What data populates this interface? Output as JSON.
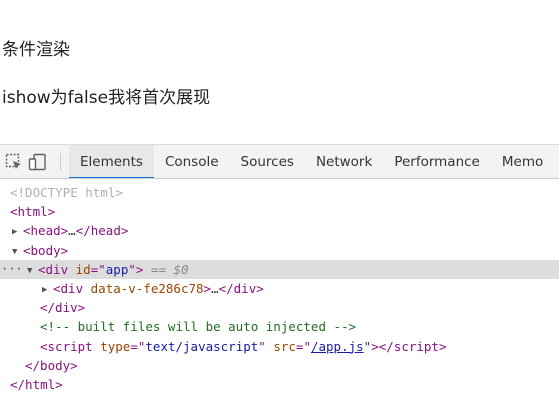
{
  "page": {
    "line1": "条件渲染",
    "line2": "ishow为false我将首次展现"
  },
  "devtools": {
    "tabs": [
      {
        "label": "Elements",
        "active": true
      },
      {
        "label": "Console",
        "active": false
      },
      {
        "label": "Sources",
        "active": false
      },
      {
        "label": "Network",
        "active": false
      },
      {
        "label": "Performance",
        "active": false
      },
      {
        "label": "Memo",
        "active": false
      }
    ],
    "icons": [
      "inspect-element-icon",
      "device-toolbar-icon"
    ],
    "accent_color": "#1a73e8",
    "tree": {
      "doctype": "<!DOCTYPE html>",
      "html_open_tag": "html",
      "head_tag": "head",
      "head_ellipsis": "…",
      "head_close_tag": "/head",
      "body_open_tag": "body",
      "div_tag": "div",
      "div_attr_name": "id",
      "div_attr_eq": "=\"",
      "div_attr_value": "app",
      "div_attr_close": "\"",
      "selected_marker": "== $0",
      "child_div_tag": "div",
      "child_div_attr": "data-v-fe286c78",
      "child_ellipsis": "…",
      "child_close_tag": "/div",
      "div_close_tag": "/div",
      "comment": "<!-- built files will be auto injected -->",
      "script_tag": "script",
      "script_type_name": "type",
      "script_type_value": "text/javascript",
      "script_src_name": "src",
      "script_src_value": "/app.js",
      "script_close_tag": "/script",
      "body_close_tag": "/body",
      "html_close_tag": "/html",
      "dots": "···"
    }
  }
}
